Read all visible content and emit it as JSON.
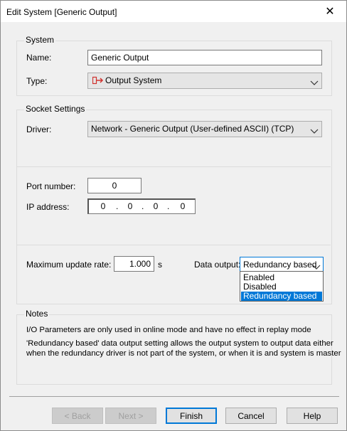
{
  "window": {
    "title": "Edit System [Generic Output]",
    "close_glyph": "✕"
  },
  "system": {
    "group_title": "System",
    "name_label": "Name:",
    "name_value": "Generic Output",
    "type_label": "Type:",
    "type_value": "Output System",
    "type_icon": "output-system-icon"
  },
  "socket": {
    "group_title": "Socket Settings",
    "driver_label": "Driver:",
    "driver_value": "Network - Generic Output (User-defined ASCII) (TCP)",
    "port_label": "Port number:",
    "port_value": "0",
    "ip_label": "IP address:",
    "ip_octets": [
      "0",
      "0",
      "0",
      "0"
    ],
    "rate_label": "Maximum update rate:",
    "rate_value": "1.000",
    "rate_unit": "s",
    "data_output_label": "Data output:",
    "data_output_value": "Redundancy based",
    "data_output_options": [
      "Enabled",
      "Disabled",
      "Redundancy based"
    ]
  },
  "notes": {
    "group_title": "Notes",
    "line1": "I/O Parameters are only used in online mode and have no effect in replay mode",
    "line2": "'Redundancy based' data output setting allows the output system to output data either",
    "line3": "when the redundancy driver is not part of the system, or when it is and system is master"
  },
  "buttons": {
    "back": "< Back",
    "next": "Next >",
    "finish": "Finish",
    "cancel": "Cancel",
    "help": "Help"
  },
  "colors": {
    "selection": "#0078d7",
    "background": "#f0f0f0",
    "icon_red": "#d0312d"
  }
}
